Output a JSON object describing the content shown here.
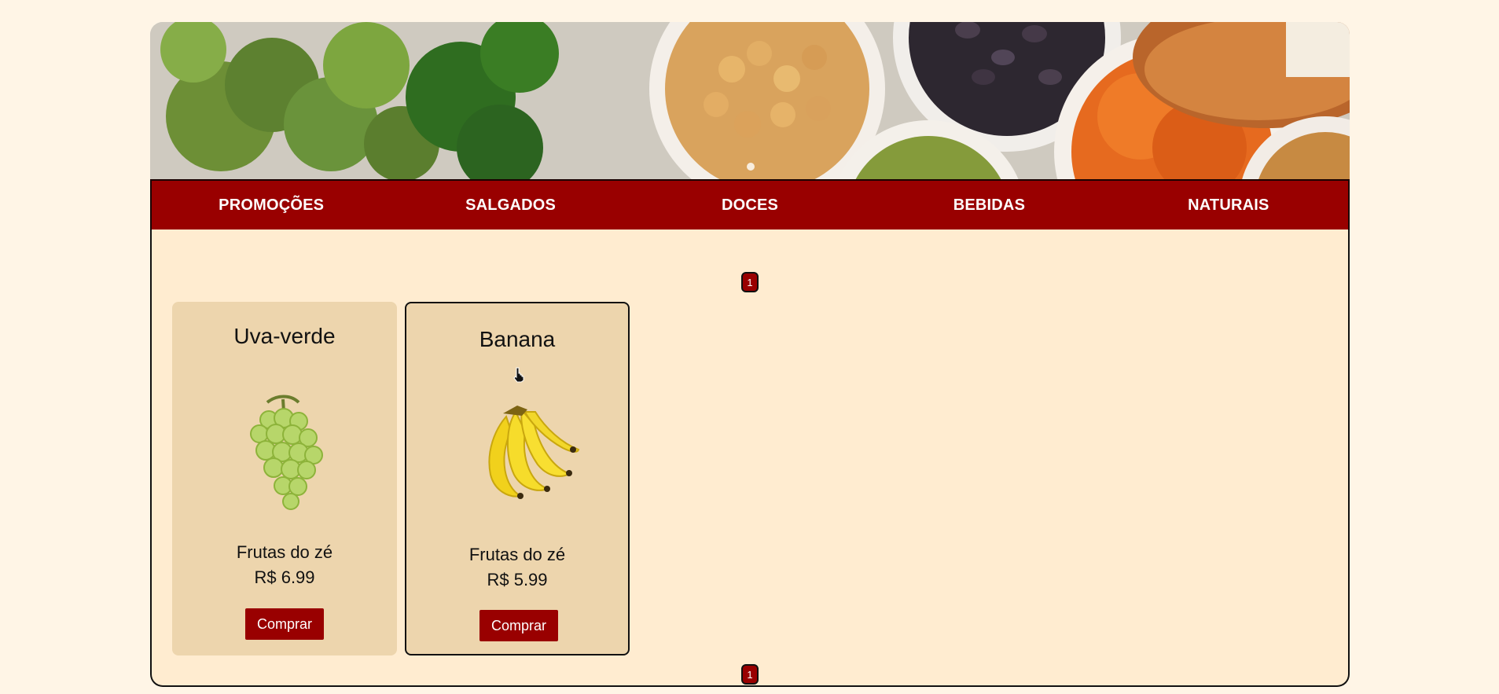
{
  "nav": {
    "items": [
      {
        "label": "PROMOÇÕES"
      },
      {
        "label": "SALGADOS"
      },
      {
        "label": "DOCES"
      },
      {
        "label": "BEBIDAS"
      },
      {
        "label": "NATURAIS"
      }
    ]
  },
  "pagination": {
    "top_page": "1",
    "bottom_page": "1"
  },
  "products": [
    {
      "name": "Uva-verde",
      "seller": "Frutas do zé",
      "price": "R$ 6.99",
      "buy_label": "Comprar",
      "image_icon": "green-grapes-icon"
    },
    {
      "name": "Banana",
      "seller": "Frutas do zé",
      "price": "R$ 5.99",
      "buy_label": "Comprar",
      "image_icon": "banana-icon"
    }
  ],
  "theme": {
    "background": "#fff5e6",
    "content_background": "#ffecd0",
    "card_background": "#edd5ad",
    "accent": "#990000"
  }
}
